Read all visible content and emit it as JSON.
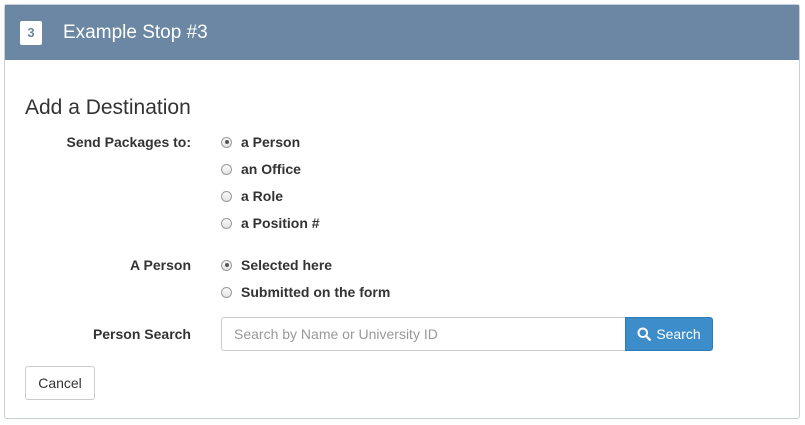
{
  "header": {
    "step_number": "3",
    "title": "Example Stop #3"
  },
  "section_title": "Add a Destination",
  "send_packages": {
    "label": "Send Packages to:",
    "options": [
      {
        "label": "a Person",
        "checked": true
      },
      {
        "label": "an Office",
        "checked": false
      },
      {
        "label": "a Role",
        "checked": false
      },
      {
        "label": "a Position #",
        "checked": false
      }
    ]
  },
  "a_person": {
    "label": "A Person",
    "options": [
      {
        "label": "Selected here",
        "checked": true
      },
      {
        "label": "Submitted on the form",
        "checked": false
      }
    ]
  },
  "person_search": {
    "label": "Person Search",
    "placeholder": "Search by Name or University ID",
    "value": "",
    "button_label": "Search",
    "button_icon": "search-icon"
  },
  "cancel_label": "Cancel",
  "colors": {
    "header_bg": "#6b87a3",
    "primary_button": "#3c8dca"
  }
}
